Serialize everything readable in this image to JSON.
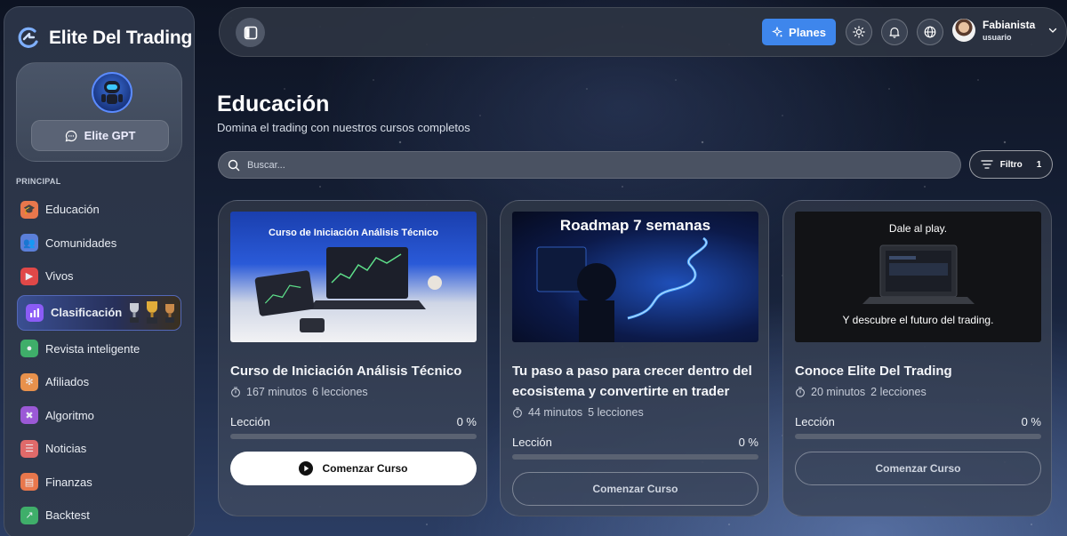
{
  "brand": {
    "name": "Elite Del Trading"
  },
  "gpt": {
    "button_label": "Elite GPT"
  },
  "sidebar": {
    "section_label": "PRINCIPAL",
    "items": [
      {
        "label": "Educación",
        "icon": "graduation-cap-icon",
        "color": "#e8774c"
      },
      {
        "label": "Comunidades",
        "icon": "people-icon",
        "color": "#5b7fd9"
      },
      {
        "label": "Vivos",
        "icon": "live-video-icon",
        "color": "#e04848"
      },
      {
        "label": "Clasificación",
        "icon": "bar-chart-icon",
        "color": "#8b5cf6"
      },
      {
        "label": "Revista inteligente",
        "icon": "magazine-icon",
        "color": "#3fae6a"
      },
      {
        "label": "Afiliados",
        "icon": "affiliates-icon",
        "color": "#e8914c"
      },
      {
        "label": "Algoritmo",
        "icon": "algorithm-icon",
        "color": "#9b59d6"
      },
      {
        "label": "Noticias",
        "icon": "news-icon",
        "color": "#e06a6a"
      },
      {
        "label": "Finanzas",
        "icon": "finance-icon",
        "color": "#e8774c"
      },
      {
        "label": "Backtest",
        "icon": "backtest-icon",
        "color": "#3fae6a"
      }
    ]
  },
  "topbar": {
    "planes_label": "Planes",
    "user": {
      "name": "Fabianista",
      "role": "usuario"
    }
  },
  "main": {
    "title": "Educación",
    "subtitle": "Domina el trading con nuestros cursos completos",
    "search_placeholder": "Buscar...",
    "filter": {
      "label": "Filtro",
      "count": "1"
    }
  },
  "courses": [
    {
      "thumb_text": "Curso de Iniciación Análisis Técnico",
      "title": "Curso de Iniciación Análisis Técnico",
      "minutes": "167 minutos",
      "lessons": "6 lecciones",
      "progress_label": "Lección",
      "progress_value": "0 %",
      "progress": 0,
      "cta": "Comenzar Curso"
    },
    {
      "thumb_text": "Roadmap 7 semanas",
      "title": "Tu paso a paso para crecer dentro del ecosistema y convertirte en trader",
      "minutes": "44 minutos",
      "lessons": "5 lecciones",
      "progress_label": "Lección",
      "progress_value": "0 %",
      "progress": 0,
      "cta": "Comenzar Curso"
    },
    {
      "thumb_text_top": "Dale al play.",
      "thumb_text_bottom": "Y descubre el futuro del trading.",
      "title": "Conoce Elite Del Trading",
      "minutes": "20 minutos",
      "lessons": "2 lecciones",
      "progress_label": "Lección",
      "progress_value": "0 %",
      "progress": 0,
      "cta": "Comenzar Curso"
    }
  ]
}
